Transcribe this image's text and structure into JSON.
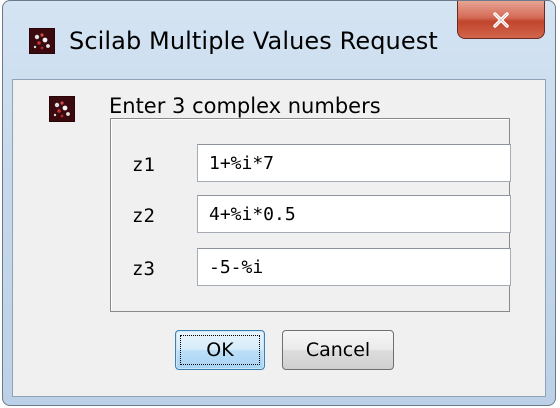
{
  "window": {
    "title": "Scilab Multiple Values Request",
    "app_icon": "scilab-icon",
    "close_icon": "close-icon"
  },
  "dialog": {
    "prompt": "Enter 3 complex numbers",
    "message_icon": "scilab-icon",
    "fields": [
      {
        "label": "z1",
        "value": "1+%i*7"
      },
      {
        "label": "z2",
        "value": "4+%i*0.5"
      },
      {
        "label": "z3",
        "value": "-5-%i"
      }
    ],
    "ok_label": "OK",
    "cancel_label": "Cancel"
  },
  "colors": {
    "close_button": "#c8503a",
    "ok_button_accent": "#3c7fb1",
    "client_background": "#f0f0f0"
  }
}
